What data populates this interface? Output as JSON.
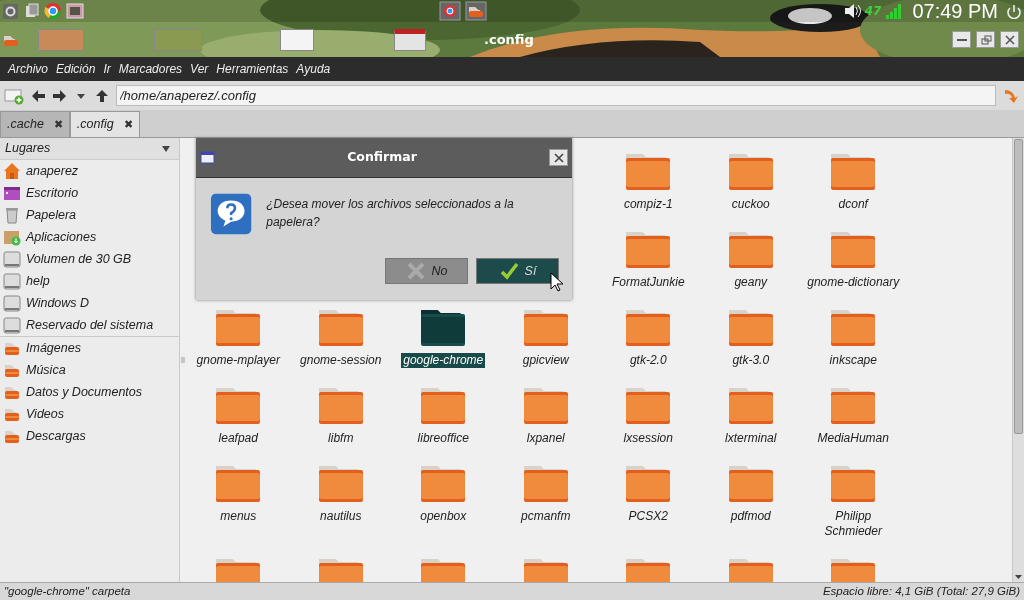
{
  "panel": {
    "tray_text": "47",
    "clock": "07:49 PM"
  },
  "taskbar": {
    "window_title": ".config"
  },
  "menu": [
    "Archivo",
    "Edición",
    "Ir",
    "Marcadores",
    "Ver",
    "Herramientas",
    "Ayuda"
  ],
  "address": {
    "value": "/home/anaperez/.config"
  },
  "tabs": [
    {
      "label": ".cache",
      "close": "✖",
      "selected": false
    },
    {
      "label": ".config",
      "close": "✖",
      "selected": true
    }
  ],
  "sidebar": {
    "title": "Lugares",
    "groups": [
      {
        "items": [
          {
            "label": "anaperez",
            "kind": "home"
          },
          {
            "label": "Escritorio",
            "kind": "desktop"
          },
          {
            "label": "Papelera",
            "kind": "trash"
          },
          {
            "label": "Aplicaciones",
            "kind": "apps"
          },
          {
            "label": "Volumen de 30 GB",
            "kind": "drive"
          },
          {
            "label": "help",
            "kind": "drive"
          },
          {
            "label": "Windows D",
            "kind": "drive"
          },
          {
            "label": "Reservado del sistema",
            "kind": "drive"
          }
        ]
      },
      {
        "items": [
          {
            "label": "Imágenes",
            "kind": "folder"
          },
          {
            "label": "Música",
            "kind": "folder"
          },
          {
            "label": "Datos y Documentos",
            "kind": "folder"
          },
          {
            "label": "Videos",
            "kind": "folder"
          },
          {
            "label": "Descargas",
            "kind": "folder"
          }
        ]
      }
    ]
  },
  "grid": {
    "rows": [
      {
        "items": [
          {
            "name": "compiz-1",
            "selected": false
          },
          {
            "name": "cuckoo",
            "selected": false
          },
          {
            "name": "dconf",
            "selected": false
          }
        ]
      },
      {
        "items": [
          {
            "name": "FormatJunkie",
            "selected": false
          },
          {
            "name": "geany",
            "selected": false
          },
          {
            "name": "gnome-dictionary",
            "selected": false
          }
        ]
      },
      {
        "items": [
          {
            "name": "gnome-mplayer",
            "selected": false
          },
          {
            "name": "gnome-session",
            "selected": false
          },
          {
            "name": "google-chrome",
            "selected": true
          },
          {
            "name": "gpicview",
            "selected": false
          },
          {
            "name": "gtk-2.0",
            "selected": false
          },
          {
            "name": "gtk-3.0",
            "selected": false
          },
          {
            "name": "inkscape",
            "selected": false
          }
        ]
      },
      {
        "items": [
          {
            "name": "leafpad",
            "selected": false
          },
          {
            "name": "libfm",
            "selected": false
          },
          {
            "name": "libreoffice",
            "selected": false
          },
          {
            "name": "lxpanel",
            "selected": false
          },
          {
            "name": "lxsession",
            "selected": false
          },
          {
            "name": "lxterminal",
            "selected": false
          },
          {
            "name": "MediaHuman",
            "selected": false
          }
        ]
      },
      {
        "items": [
          {
            "name": "menus",
            "selected": false
          },
          {
            "name": "nautilus",
            "selected": false
          },
          {
            "name": "openbox",
            "selected": false
          },
          {
            "name": "pcmanfm",
            "selected": false
          },
          {
            "name": "PCSX2",
            "selected": false
          },
          {
            "name": "pdfmod",
            "selected": false
          },
          {
            "name": "Philipp Schmieder",
            "selected": false
          }
        ]
      },
      {
        "items": [
          {
            "selected": false
          },
          {
            "selected": false
          },
          {
            "selected": false
          },
          {
            "selected": false
          },
          {
            "selected": false
          },
          {
            "selected": false
          },
          {
            "selected": false
          }
        ]
      }
    ]
  },
  "dialog": {
    "title": "Confirmar",
    "message": "¿Desea mover los archivos seleccionados a la papelera?",
    "buttons": [
      {
        "label": "No",
        "kind": "no",
        "selected": false
      },
      {
        "label": "Sí",
        "kind": "yes",
        "selected": true
      }
    ]
  },
  "status": {
    "left": "\"google-chrome\" carpeta",
    "right": "Espacio libre: 4,1 GiB (Total: 27,9 GiB)"
  }
}
